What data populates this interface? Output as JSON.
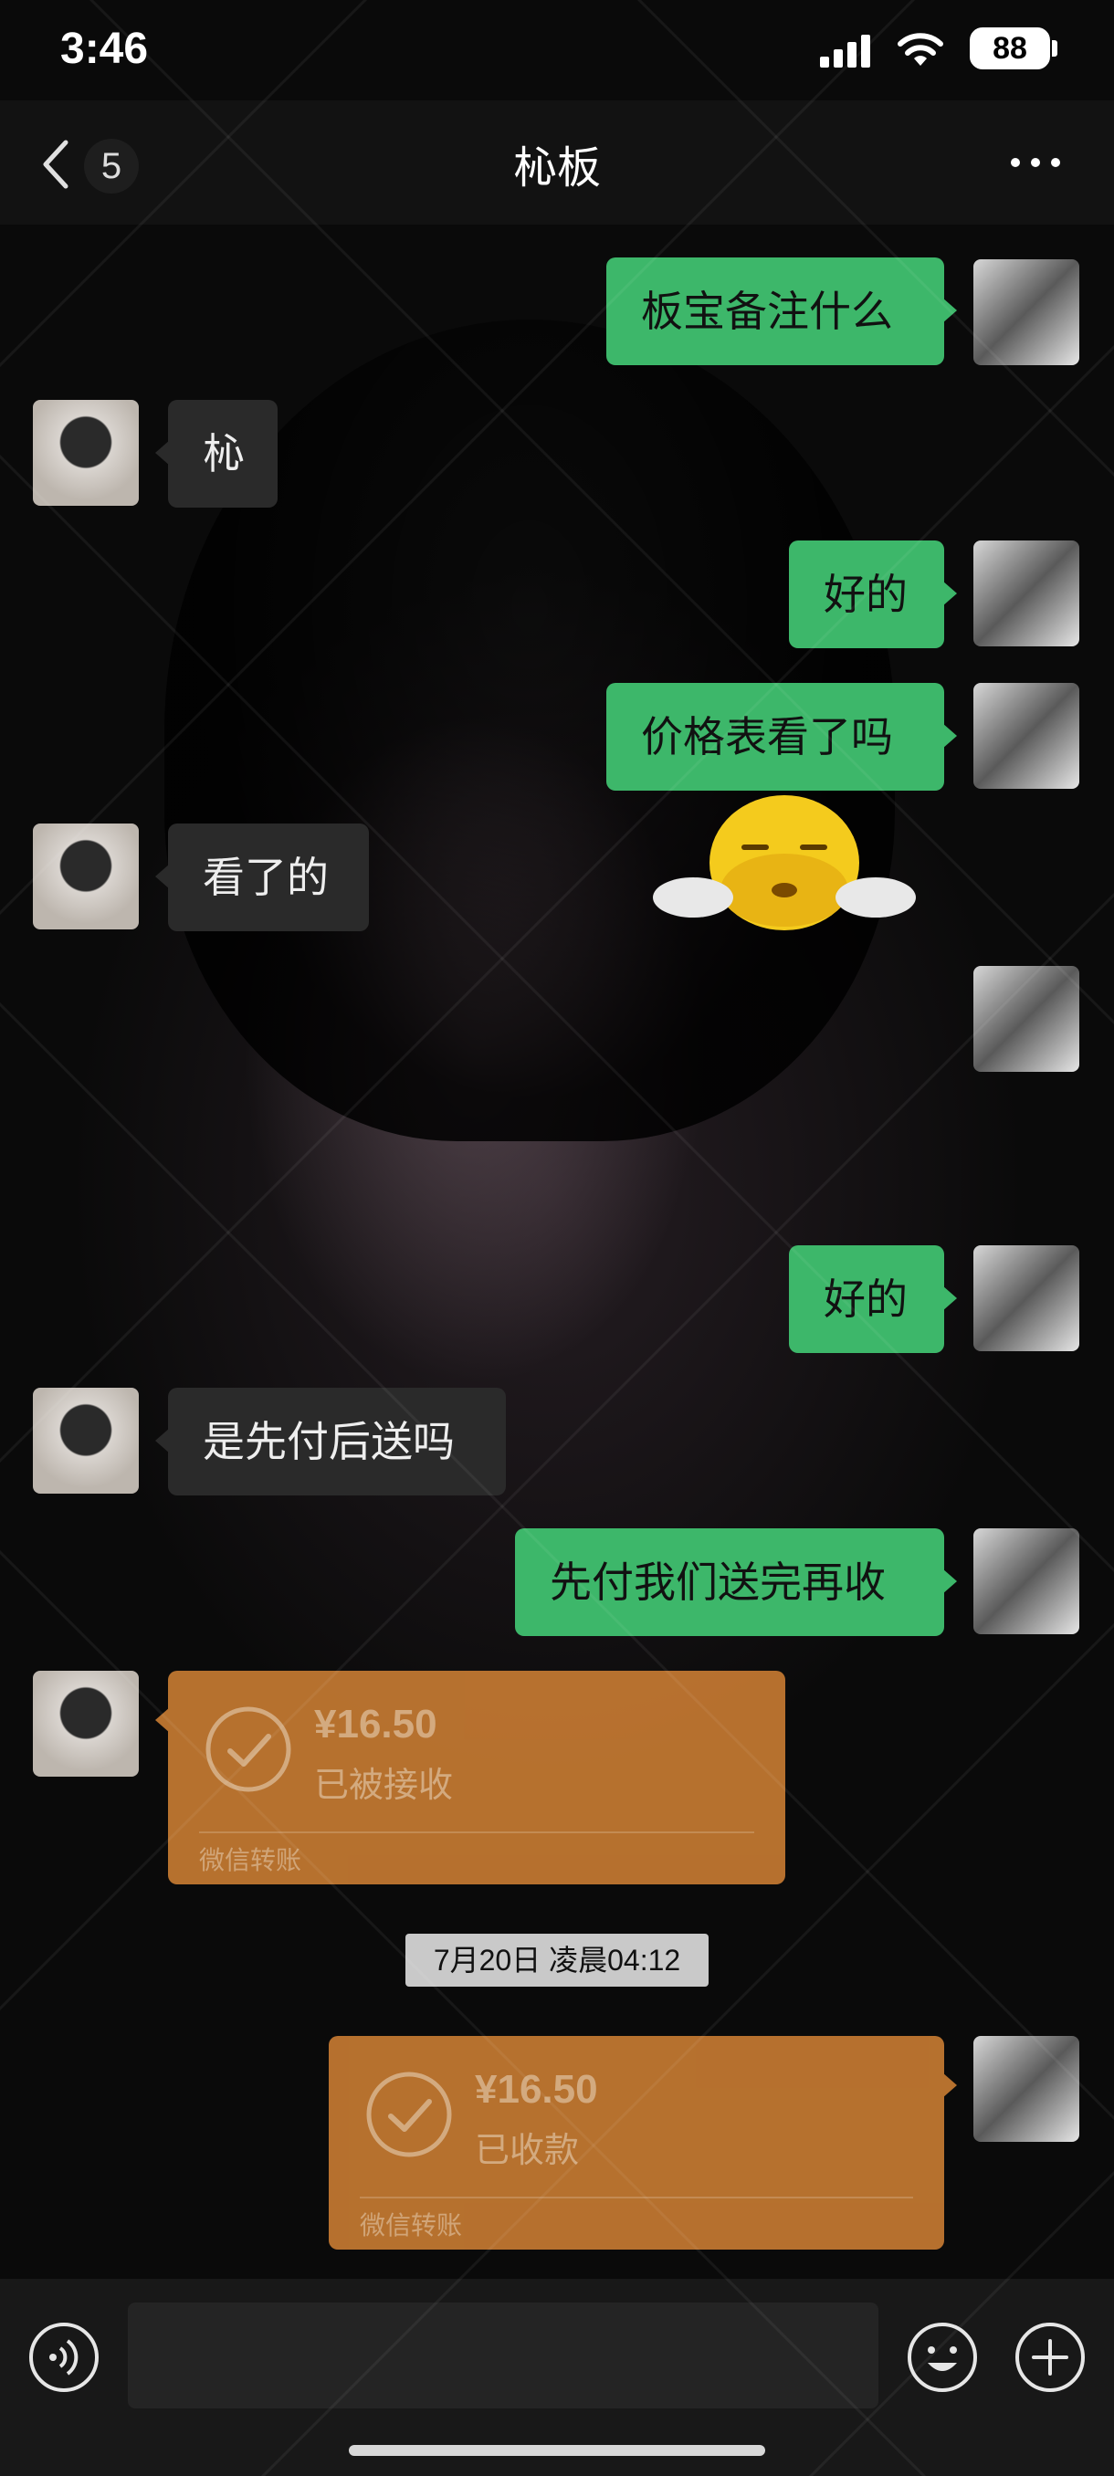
{
  "status_bar": {
    "time": "3:46",
    "battery": "88"
  },
  "nav": {
    "back_count": "5",
    "title": "杺板"
  },
  "messages": [
    {
      "text": "板宝备注什么"
    },
    {
      "text": "杺"
    },
    {
      "text": "好的"
    },
    {
      "text": "价格表看了吗"
    },
    {
      "text": "看了的"
    },
    {
      "text": "好的"
    },
    {
      "text": "是先付后送吗"
    },
    {
      "text": "先付我们送完再收"
    }
  ],
  "transfers": [
    {
      "amount": "¥16.50",
      "state": "已被接收",
      "brand": "微信转账"
    },
    {
      "amount": "¥16.50",
      "state": "已收款",
      "brand": "微信转账"
    }
  ],
  "timestamp": "7月20日 凌晨04:12",
  "colors": {
    "outgoing_bubble": "#3db76a",
    "incoming_bubble": "#2a2a2a",
    "transfer_card": "#c57a32"
  },
  "icons": {
    "back": "chevron-left-icon",
    "more": "more-dots-icon",
    "voice": "voice-icon",
    "emoji": "emoji-icon",
    "plus": "plus-icon",
    "check": "check-circle-icon"
  }
}
